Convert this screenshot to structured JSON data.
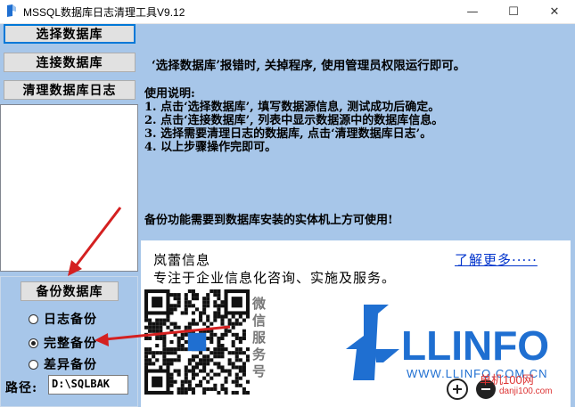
{
  "window": {
    "title": "MSSQL数据库日志清理工具V9.12",
    "minimize_glyph": "—",
    "maximize_glyph": "☐",
    "close_glyph": "✕"
  },
  "buttons": {
    "select_db": "选择数据库",
    "connect_db": "连接数据库",
    "clear_log": "清理数据库日志",
    "backup_db": "备份数据库"
  },
  "backup_options": [
    {
      "label": "日志备份",
      "selected": false
    },
    {
      "label": "完整备份",
      "selected": true
    },
    {
      "label": "差异备份",
      "selected": false
    }
  ],
  "path": {
    "label": "路径:",
    "value": "D:\\SQLBAK"
  },
  "notes": {
    "warning": "‘选择数据库’报错时, 关掉程序, 使用管理员权限运行即可。",
    "usage_title": "使用说明:",
    "steps": [
      "1. 点击‘选择数据库’, 填写数据源信息, 测试成功后确定。",
      "2. 点击‘连接数据库’, 列表中显示数据源中的数据库信息。",
      "3. 选择需要清理日志的数据库, 点击‘清理数据库日志’。",
      "4. 以上步骤操作完即可。"
    ],
    "backup_note": "备份功能需要到数据库安装的实体机上方可使用!"
  },
  "info": {
    "brand": "岚蕾信息",
    "slogan": "专注于企业信息化咨询、实施及服务。",
    "more_link": "了解更多·····",
    "wechat": [
      "微",
      "信",
      "服",
      "务",
      "号"
    ],
    "logo_text": "LLINFO",
    "logo_url": "WWW.LLINFO.COM.CN",
    "watermark": "单机100网",
    "watermark_url": "danji100.com"
  },
  "colors": {
    "client_bg": "#a7c6e9",
    "accent": "#0078d7",
    "logo_blue": "#1f6fd1",
    "arrow_red": "#d42020"
  }
}
